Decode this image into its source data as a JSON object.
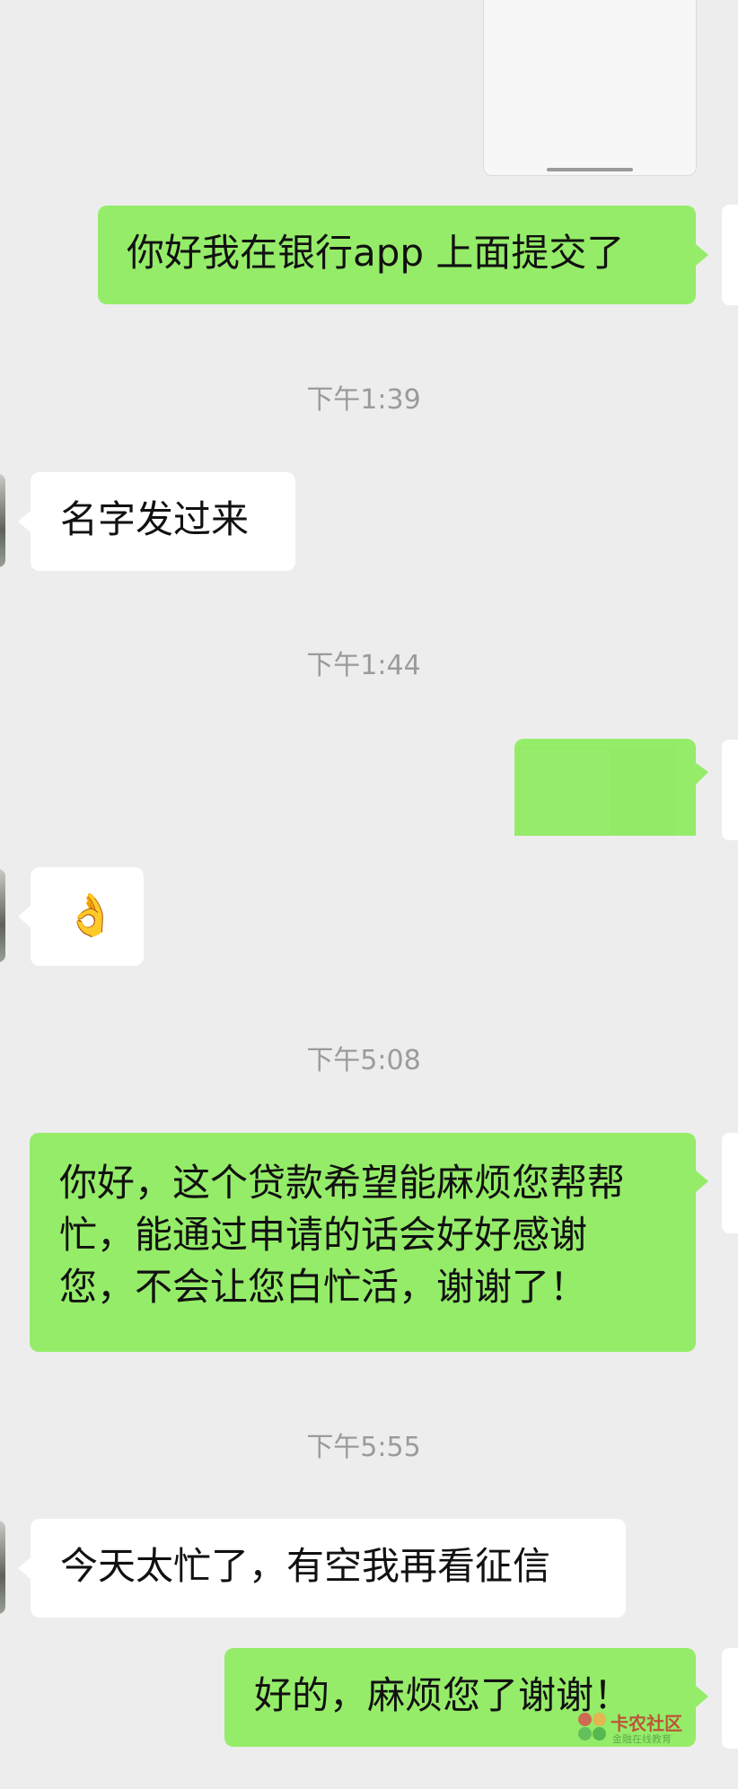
{
  "messages": {
    "m1_sent": "你好我在银行app 上面提交了",
    "m2_time": "下午1:39",
    "m3_recv": "名字发过来",
    "m4_time": "下午1:44",
    "m6_recv_emoji": "👌",
    "m7_time": "下午5:08",
    "m8_sent_lines": [
      "你好，这个贷款希望能麻烦您帮帮",
      "忙，能通过申请的话会好好感谢",
      "您，不会让您白忙活，谢谢了！"
    ],
    "m9_time": "下午5:55",
    "m10_recv": "今天太忙了，有空我再看征信",
    "m11_sent": "好的，麻烦您了谢谢！"
  },
  "watermark": {
    "name": "卡农社区",
    "tagline": "金融在线教育"
  },
  "colors": {
    "background": "#ededed",
    "sent_bubble": "#95ec69",
    "recv_bubble": "#ffffff",
    "timestamp": "#9b9b9b"
  }
}
